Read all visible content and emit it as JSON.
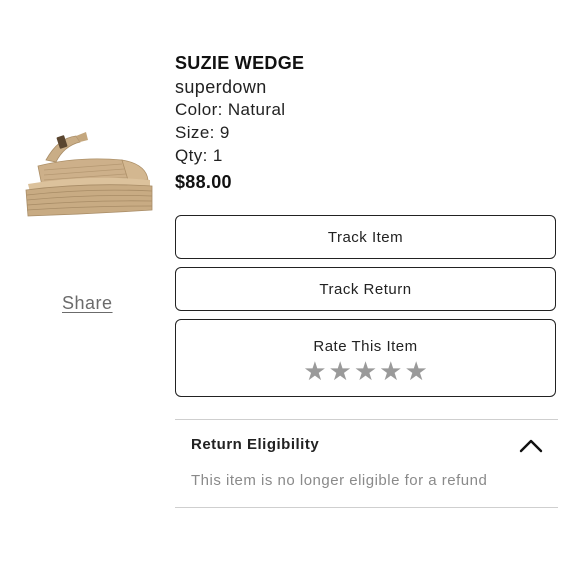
{
  "product": {
    "name": "SUZIE WEDGE",
    "brand": "superdown",
    "color": "Color: Natural",
    "size": "Size: 9",
    "qty": "Qty: 1",
    "price": "$88.00",
    "image_icon": "wedge-sandal-image"
  },
  "actions": {
    "share_label": "Share",
    "track_item_label": "Track Item",
    "track_return_label": "Track Return"
  },
  "rating": {
    "label": "Rate This Item",
    "stars": [
      "★",
      "★",
      "★",
      "★",
      "★"
    ],
    "star_color": "#9a9a9a"
  },
  "return_eligibility": {
    "title": "Return Eligibility",
    "message": "This item is no longer eligible for a refund",
    "toggle_icon": "chevron-up-icon"
  }
}
